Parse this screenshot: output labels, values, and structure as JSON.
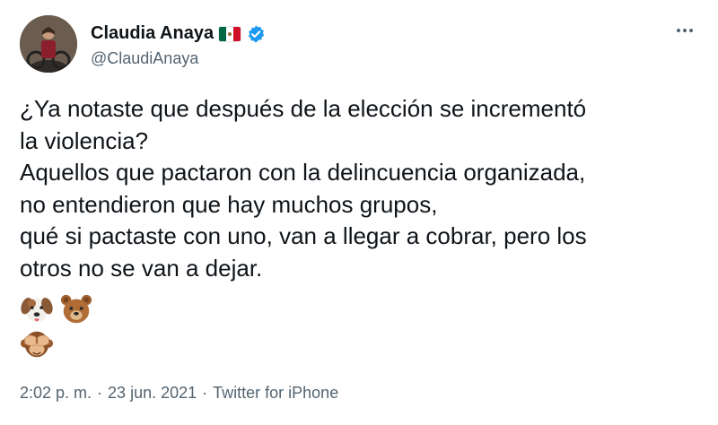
{
  "author": {
    "display_name": "Claudia Anaya",
    "handle": "@ClaudiAnaya",
    "flag_icon": "mexico-flag",
    "verified_icon": "verified-badge",
    "verified_color": "#1d9bf0"
  },
  "more_menu_icon": "more-horizontal-icon",
  "tweet": {
    "lines": [
      "¿Ya notaste que después de la elección se incrementó",
      "la violencia?",
      "Aquellos que pactaron con la delincuencia organizada,",
      "no entendieron que hay muchos grupos,",
      "qué si pactaste con uno, van a llegar a cobrar, pero los",
      "otros no se van a dejar."
    ],
    "emojis": [
      "dog-face",
      "bear-face",
      "see-no-evil-monkey"
    ]
  },
  "meta": {
    "time": "2:02 p. m.",
    "separator": "·",
    "date": "23 jun. 2021",
    "source": "Twitter for iPhone"
  },
  "colors": {
    "text": "#0f1419",
    "secondary": "#536471",
    "flag_green": "#006847",
    "flag_white": "#ffffff",
    "flag_red": "#ce1126"
  }
}
